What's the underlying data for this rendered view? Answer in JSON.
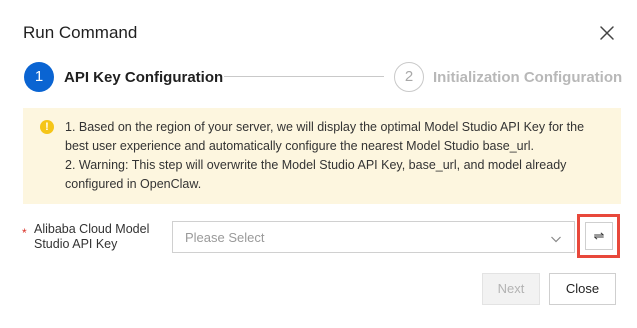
{
  "dialog": {
    "title": "Run Command",
    "close_icon": "close-icon"
  },
  "steps": [
    {
      "number": "1",
      "label": "API Key Configuration",
      "state": "active"
    },
    {
      "number": "2",
      "label": "Initialization Configuration",
      "state": "pending"
    }
  ],
  "notice": {
    "icon": "warning-icon",
    "icon_glyph": "!",
    "line1": "1. Based on the region of your server, we will display the optimal Model Studio API Key for the best user experience and automatically configure the nearest Model Studio base_url.",
    "line2": "2. Warning: This step will overwrite the Model Studio API Key, base_url, and model already configured in OpenClaw."
  },
  "form": {
    "required_mark": "*",
    "label": "Alibaba Cloud Model Studio API Key",
    "select_placeholder": "Please Select",
    "caret_icon": "chevron-down-icon",
    "swap_icon": "swap-icon",
    "swap_glyph": "⇌"
  },
  "buttons": {
    "next": "Next",
    "close": "Close"
  },
  "colors": {
    "primary": "#0a64d2",
    "notice_bg": "#fdf6df",
    "warning": "#f5c518",
    "required": "#d93026",
    "highlight": "#e8483b"
  }
}
